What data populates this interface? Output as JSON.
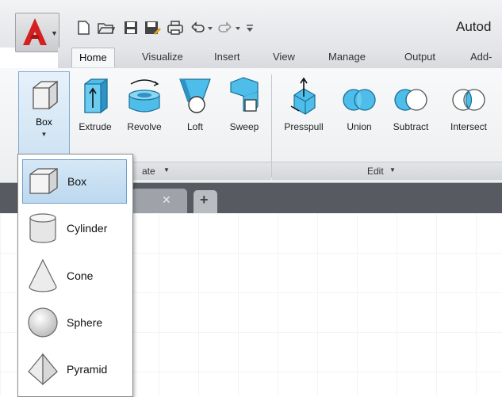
{
  "window": {
    "title": "Autod"
  },
  "quick_access": [
    "new-icon",
    "open-icon",
    "save-icon",
    "save-as-icon",
    "plot-icon",
    "undo-icon",
    "redo-icon",
    "customize-icon"
  ],
  "tabs": [
    "Home",
    "Visualize",
    "Insert",
    "View",
    "Manage",
    "Output",
    "Add-"
  ],
  "active_tab": "Home",
  "ribbon": {
    "modeling": {
      "box": {
        "label": "Box"
      },
      "buttons": [
        "Extrude",
        "Revolve",
        "Loft",
        "Sweep"
      ],
      "panel_title": "ate"
    },
    "edit": {
      "buttons": [
        "Presspull",
        "Union",
        "Subtract",
        "Intersect"
      ],
      "panel_title": "Edit"
    }
  },
  "dropdown": {
    "items": [
      "Box",
      "Cylinder",
      "Cone",
      "Sphere",
      "Pyramid"
    ],
    "selected": "Box"
  },
  "colors": {
    "accent": "#cfe3f3",
    "app_red": "#d42020",
    "icon_blue": "#3fb6e6"
  }
}
